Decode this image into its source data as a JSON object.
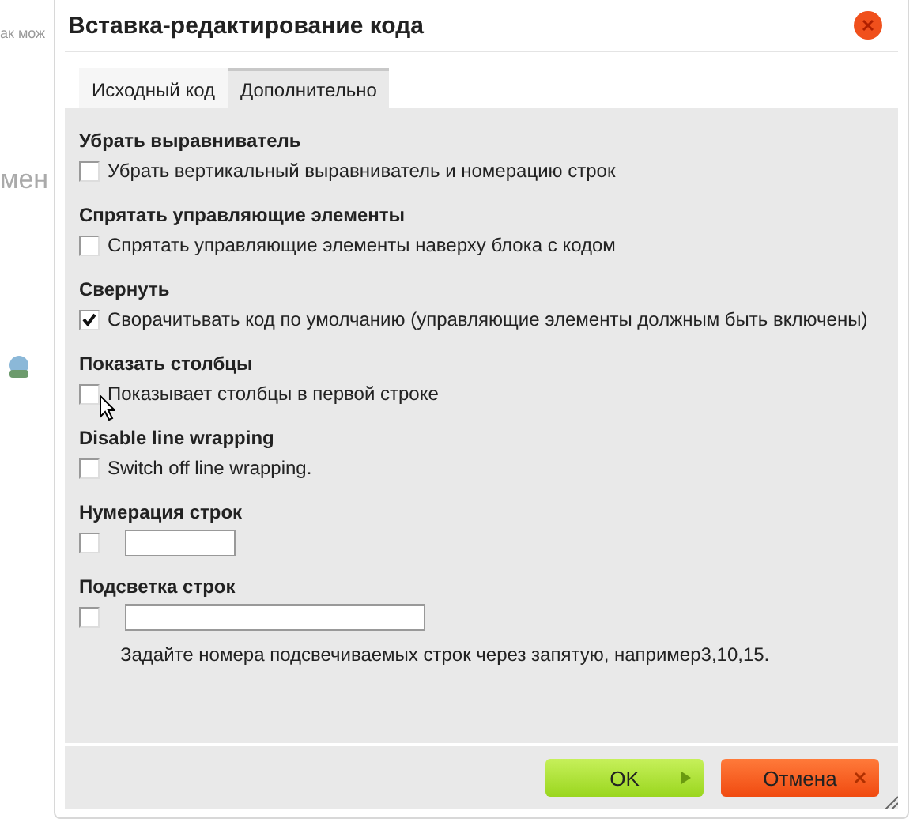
{
  "background": {
    "texts": [
      "ак мож",
      "мен"
    ]
  },
  "dialog": {
    "title": "Вставка-редактирование кода",
    "tabs": [
      {
        "label": "Исходный код",
        "selected": false
      },
      {
        "label": "Дополнительно",
        "selected": true
      }
    ],
    "sections": [
      {
        "heading": "Убрать выравниватель",
        "kind": "checkbox",
        "checked": false,
        "label": "Убрать вертикальный выравниватель и номерацию строк"
      },
      {
        "heading": "Спрятать управляющие элементы",
        "kind": "checkbox",
        "checked": false,
        "label": "Спрятать управляющие элементы наверху блока с кодом"
      },
      {
        "heading": "Свернуть",
        "kind": "checkbox",
        "checked": true,
        "label": "Сворачитьвать код по умолчанию (управляющие элементы должным быть включены)"
      },
      {
        "heading": "Показать столбцы",
        "kind": "checkbox",
        "checked": false,
        "label": "Показывает столбцы в первой строке"
      },
      {
        "heading": "Disable line wrapping",
        "kind": "checkbox",
        "checked": false,
        "label": "Switch off line wrapping."
      },
      {
        "heading": "Нумерация строк",
        "kind": "short-field",
        "checked": false
      },
      {
        "heading": "Подсветка строк",
        "kind": "long-field",
        "checked": false,
        "hint": "Задайте номера подсвечиваемых строк через запятую, например3,10,15."
      }
    ],
    "buttons": [
      {
        "label": "OK",
        "kind": "ok"
      },
      {
        "label": "Отмена",
        "kind": "cancel"
      }
    ]
  }
}
